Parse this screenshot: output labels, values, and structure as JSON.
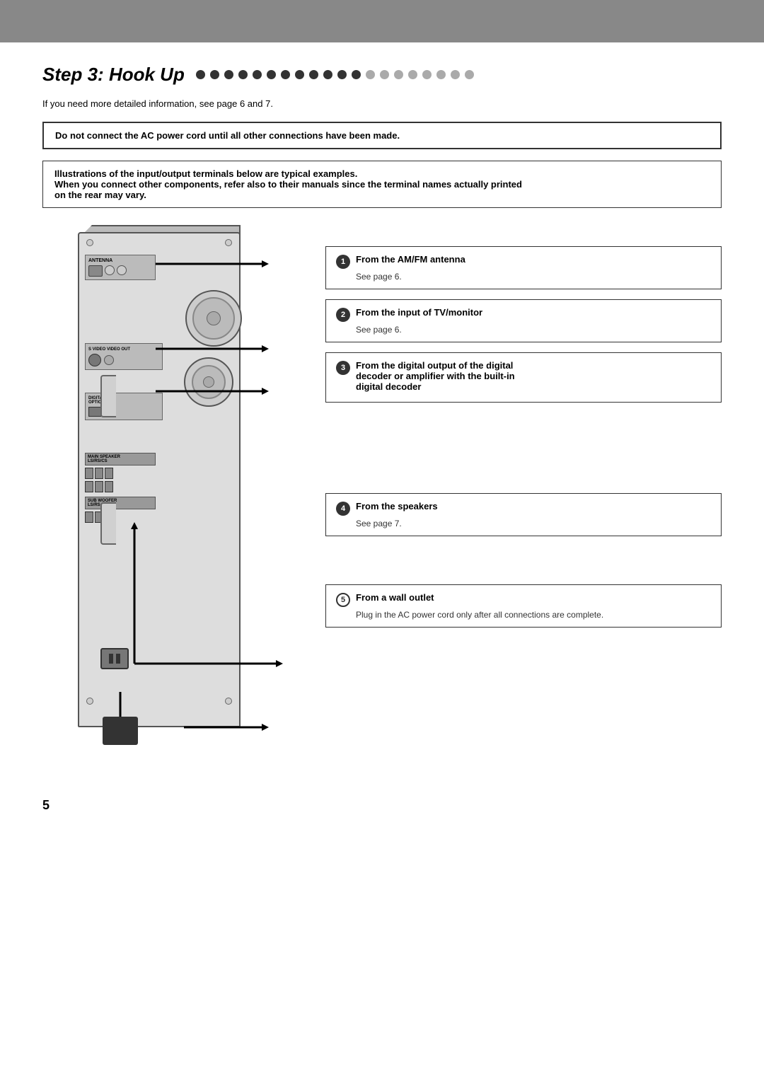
{
  "page": {
    "top_bar_color": "#888888",
    "step_label": "Step",
    "step_number": "3",
    "step_title": "Hook Up",
    "subtitle": "If you need more detailed information, see page 6 and 7.",
    "warning_text": "Do not connect the AC power cord until all other connections have been made.",
    "info_text_line1": "Illustrations of the input/output terminals below are typical examples.",
    "info_text_line2": "When you connect other components, refer also to their manuals since the terminal names actually printed",
    "info_text_line3": "on the rear may vary.",
    "dots": {
      "total": 20,
      "dark_count": 12,
      "light_count": 8
    },
    "callouts": [
      {
        "num": "1",
        "style": "filled",
        "title": "From the AM/FM antenna",
        "sub": "See page 6."
      },
      {
        "num": "2",
        "style": "filled",
        "title": "From the input of TV/monitor",
        "sub": "See page 6."
      },
      {
        "num": "3",
        "style": "filled",
        "title": "From the digital output of the digital",
        "title2": "decoder or amplifier with the built-in",
        "title3": "digital decoder",
        "sub": ""
      },
      {
        "num": "4",
        "style": "filled",
        "title": "From the speakers",
        "sub": "See page 7."
      },
      {
        "num": "5",
        "style": "outline",
        "title": "From a wall outlet",
        "sub": "Plug in the AC power cord only after all connections are complete."
      }
    ],
    "page_number": "5"
  }
}
